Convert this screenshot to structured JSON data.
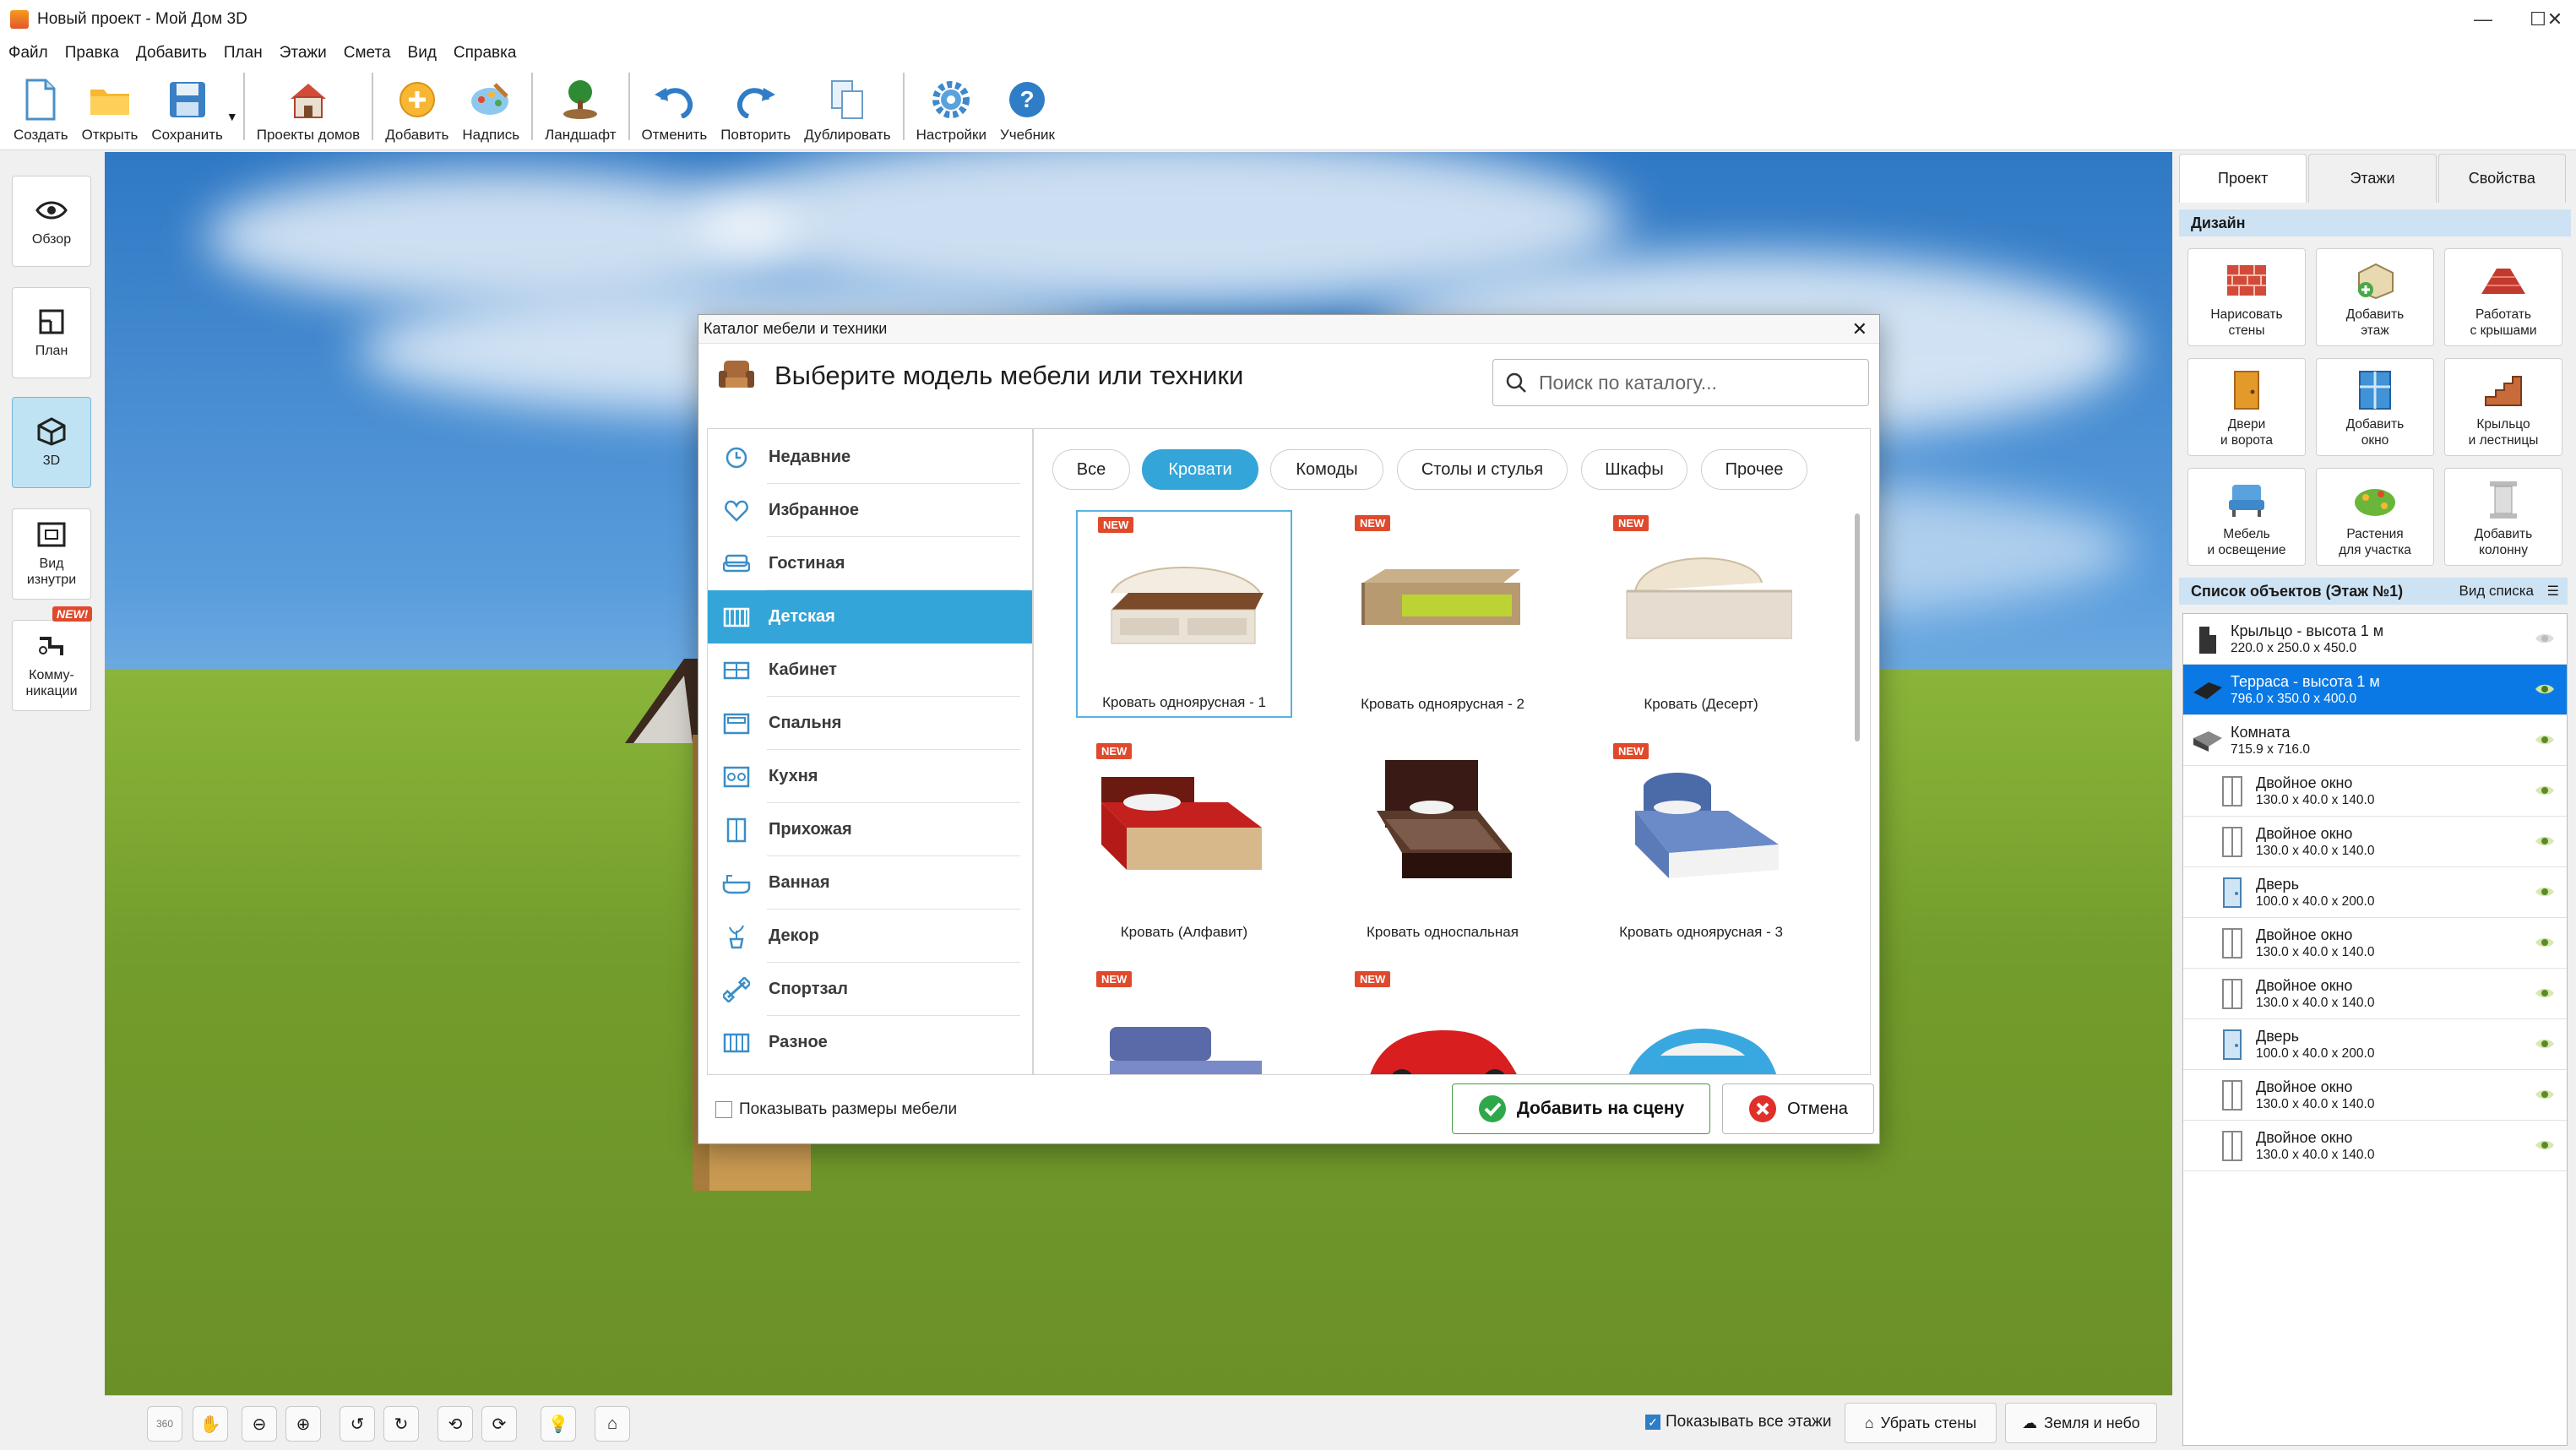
{
  "window": {
    "title": "Новый проект - Мой Дом 3D"
  },
  "menu": [
    "Файл",
    "Правка",
    "Добавить",
    "План",
    "Этажи",
    "Смета",
    "Вид",
    "Справка"
  ],
  "toolbar": {
    "create": "Создать",
    "open": "Открыть",
    "save": "Сохранить",
    "projects": "Проекты домов",
    "add": "Добавить",
    "label": "Надпись",
    "landscape": "Ландшафт",
    "undo": "Отменить",
    "redo": "Повторить",
    "duplicate": "Дублировать",
    "settings": "Настройки",
    "tutorial": "Учебник"
  },
  "leftbar": {
    "overview": "Обзор",
    "plan": "План",
    "view3d": "3D",
    "inside_l1": "Вид",
    "inside_l2": "изнутри",
    "comm_l1": "Комму-",
    "comm_l2": "никации",
    "new_badge": "NEW!"
  },
  "bottombar": {
    "icon360": "360",
    "show_floors": "Показывать все этажи",
    "remove_walls": "Убрать стены",
    "ground_sky": "Земля и небо"
  },
  "rightpanel": {
    "tabs": [
      "Проект",
      "Этажи",
      "Свойства"
    ],
    "design_header": "Дизайн",
    "design": [
      {
        "l1": "Нарисовать",
        "l2": "стены"
      },
      {
        "l1": "Добавить",
        "l2": "этаж"
      },
      {
        "l1": "Работать",
        "l2": "с крышами"
      },
      {
        "l1": "Двери",
        "l2": "и ворота"
      },
      {
        "l1": "Добавить",
        "l2": "окно"
      },
      {
        "l1": "Крыльцо",
        "l2": "и лестницы"
      },
      {
        "l1": "Мебель",
        "l2": "и освещение"
      },
      {
        "l1": "Растения",
        "l2": "для участка"
      },
      {
        "l1": "Добавить",
        "l2": "колонну"
      }
    ],
    "objects_header": "Список объектов (Этаж №1)",
    "list_view": "Вид списка",
    "objects": [
      {
        "name": "Крыльцо - высота 1 м",
        "dims": "220.0 x 250.0 x 450.0"
      },
      {
        "name": "Терраса - высота 1 м",
        "dims": "796.0 x 350.0 x 400.0"
      },
      {
        "name": "Комната",
        "dims": "715.9 x 716.0"
      },
      {
        "name": "Двойное окно",
        "dims": "130.0 x 40.0 x 140.0"
      },
      {
        "name": "Двойное окно",
        "dims": "130.0 x 40.0 x 140.0"
      },
      {
        "name": "Дверь",
        "dims": "100.0 x 40.0 x 200.0"
      },
      {
        "name": "Двойное окно",
        "dims": "130.0 x 40.0 x 140.0"
      },
      {
        "name": "Двойное окно",
        "dims": "130.0 x 40.0 x 140.0"
      },
      {
        "name": "Дверь",
        "dims": "100.0 x 40.0 x 200.0"
      },
      {
        "name": "Двойное окно",
        "dims": "130.0 x 40.0 x 140.0"
      },
      {
        "name": "Двойное окно",
        "dims": "130.0 x 40.0 x 140.0"
      }
    ]
  },
  "dialog": {
    "title": "Каталог мебели и техники",
    "heading": "Выберите модель мебели или техники",
    "search_placeholder": "Поиск по каталогу...",
    "categories": [
      "Недавние",
      "Избранное",
      "Гостиная",
      "Детская",
      "Кабинет",
      "Спальня",
      "Кухня",
      "Прихожая",
      "Ванная",
      "Декор",
      "Спортзал",
      "Разное"
    ],
    "filters": [
      "Все",
      "Кровати",
      "Комоды",
      "Столы и стулья",
      "Шкафы",
      "Прочее"
    ],
    "new_tag": "NEW",
    "items": [
      {
        "name": "Кровать одноярусная - 1"
      },
      {
        "name": "Кровать одноярусная - 2"
      },
      {
        "name": "Кровать (Десерт)"
      },
      {
        "name": "Кровать (Алфавит)"
      },
      {
        "name": "Кровать односпальная"
      },
      {
        "name": "Кровать одноярусная - 3"
      }
    ],
    "show_sizes": "Показывать размеры мебели",
    "add_button": "Добавить на сцену",
    "cancel_button": "Отмена"
  }
}
